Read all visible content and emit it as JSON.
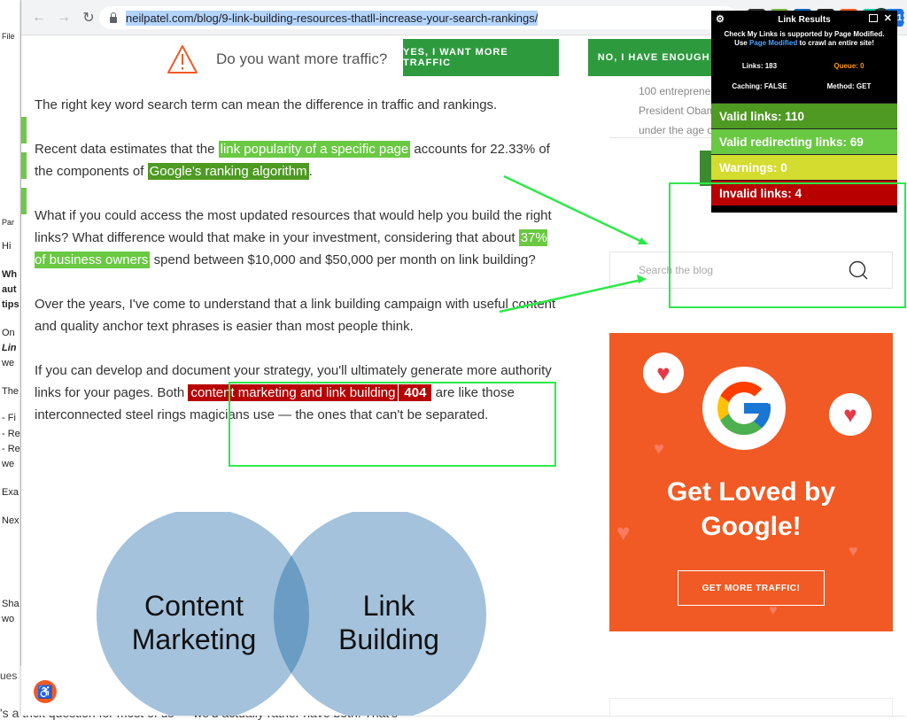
{
  "background_window": {
    "lines": [
      "File",
      "Par",
      "Hi",
      "Wh",
      "aut",
      "tips",
      "On",
      "Lin",
      "we",
      "The",
      "- Fi",
      "- Re",
      "- Re",
      "we",
      "Exa",
      "Nex",
      "Sha",
      "wo"
    ],
    "bottom_question": "ues",
    "bottom_text": "'s a trick question for most of us — we'd actually rather have both. That's"
  },
  "browser": {
    "url": "neilpatel.com/blog/9-link-building-resources-thatll-increase-your-search-rankings/",
    "nav": {
      "back": "←",
      "forward": "→",
      "reload": "↻"
    },
    "star": "☆",
    "extensions": [
      {
        "name": "gmail-ext",
        "label": "M",
        "color": "#333333"
      },
      {
        "name": "js-ext",
        "label": "JS",
        "color": "#7cb342"
      },
      {
        "name": "counter-ext",
        "label": "0",
        "color": "#1565c0"
      },
      {
        "name": "check-ext",
        "label": "✔",
        "color": "#222222"
      },
      {
        "name": "colors-ext",
        "label": "■",
        "color": "#ff5722"
      },
      {
        "name": "grammarly-ext",
        "label": "G",
        "color": "#15c39a"
      },
      {
        "name": "calendar-ext",
        "label": "181",
        "color": "#1a73e8"
      }
    ],
    "avatar": "J",
    "menu": "⋮"
  },
  "topbar": {
    "question": "Do you want more traffic?",
    "yes_label": "YES, I WANT MORE TRAFFIC",
    "no_label": "NO, I HAVE ENOUGH T"
  },
  "article": {
    "p1": "The right key word search term can mean the difference in traffic and rankings.",
    "p2_a": "Recent data estimates that the ",
    "p2_link1": "link popularity of a specific page",
    "p2_b": " accounts for 22.33% of the components of ",
    "p2_link2": "Google's ranking algorithm",
    "p2_c": ".",
    "p3_a": "What if you could access the most updated resources that would help you build the right links? What difference would that make in your investment, considering that about ",
    "p3_link": "37% of business owners",
    "p3_b": " spend between $10,000 and $50,000 per month on link building?",
    "p4": "Over the years, I've come to understand that a link building campaign with useful content and quality anchor text phrases is easier than most people think.",
    "p5_a": "If you can develop and document your strategy, you'll ultimately generate more authority links for your pages. Both ",
    "p5_link": "content marketing and link building",
    "p5_badge": "404",
    "p5_b": " are like those interconnected steel rings magicians use — the ones that can't be separated."
  },
  "venn": {
    "left_line1": "Content",
    "left_line2": "Marketing",
    "right_line1": "Link",
    "right_line2": "Building"
  },
  "sidebar": {
    "snippet_lines": [
      "100 entrepreneu",
      "President Obam",
      "under the age o"
    ],
    "search_placeholder": "Search the blog",
    "promo_title_line1": "Get Loved by",
    "promo_title_line2": "Google!",
    "promo_button": "GET MORE TRAFFIC!"
  },
  "link_results": {
    "title": "Link Results",
    "notice_a": "Check My Links is supported by Page Modified.",
    "notice_b_pre": "Use ",
    "notice_b_link": "Page Modified",
    "notice_b_post": " to crawl an entire site!",
    "links": "Links: 183",
    "queue": "Queue: 0",
    "caching": "Caching: FALSE",
    "method": "Method: GET",
    "valid": "Valid links: 110",
    "redirecting": "Valid redirecting links: 69",
    "warnings": "Warnings: 0",
    "invalid": "Invalid links: 4",
    "colors": {
      "valid": "#4e9a23",
      "redirecting": "#69c942",
      "warnings": "#d4dc2f",
      "invalid": "#b80000"
    }
  },
  "accessibility_icon": "♿",
  "colors": {
    "accent_green": "#2e9a3e",
    "promo_orange": "#f15a24",
    "annotation_green": "#2ee84a",
    "venn_blue": "#a4c2dc"
  }
}
